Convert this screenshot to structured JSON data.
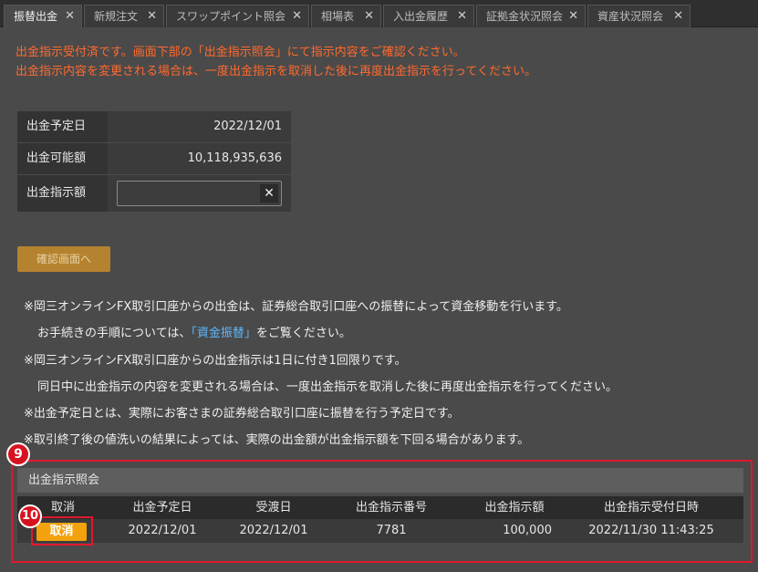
{
  "tabs": [
    {
      "label": "振替出金",
      "active": true
    },
    {
      "label": "新規注文"
    },
    {
      "label": "スワップポイント照会"
    },
    {
      "label": "相場表"
    },
    {
      "label": "入出金履歴"
    },
    {
      "label": "証拠金状況照会"
    },
    {
      "label": "資産状況照会"
    }
  ],
  "notice": [
    "出金指示受付済です。画面下部の「出金指示照会」にて指示内容をご確認ください。",
    "出金指示内容を変更される場合は、一度出金指示を取消した後に再度出金指示を行ってください。"
  ],
  "form": {
    "scheduled_date_label": "出金予定日",
    "scheduled_date_value": "2022/12/01",
    "available_label": "出金可能額",
    "available_value": "10,118,935,636",
    "amount_label": "出金指示額",
    "amount_value": "",
    "clear_icon": "✕",
    "confirm_button": "確認画面へ"
  },
  "notes": {
    "n1": "※岡三オンラインFX取引口座からの出金は、証券総合取引口座への振替によって資金移動を行います。",
    "n2_pre": "お手続きの手順については、",
    "n2_link": "「資金振替」",
    "n2_post": "をご覧ください。",
    "n3": "※岡三オンラインFX取引口座からの出金指示は1日に付き1回限りです。",
    "n4": "同日中に出金指示の内容を変更される場合は、一度出金指示を取消した後に再度出金指示を行ってください。",
    "n5": "※出金予定日とは、実際にお客さまの証券総合取引口座に振替を行う予定日です。",
    "n6": "※取引終了後の値洗いの結果によっては、実際の出金額が出金指示額を下回る場合があります。"
  },
  "inquiry": {
    "title": "出金指示照会",
    "columns": [
      "取消",
      "出金予定日",
      "受渡日",
      "出金指示番号",
      "出金指示額",
      "出金指示受付日時"
    ],
    "row": {
      "cancel": "取消",
      "scheduled_date": "2022/12/01",
      "delivery_date": "2022/12/01",
      "number": "7781",
      "amount": "100,000",
      "received_at": "2022/11/30 11:43:25"
    }
  },
  "badges": {
    "b9": "9",
    "b10": "10"
  }
}
